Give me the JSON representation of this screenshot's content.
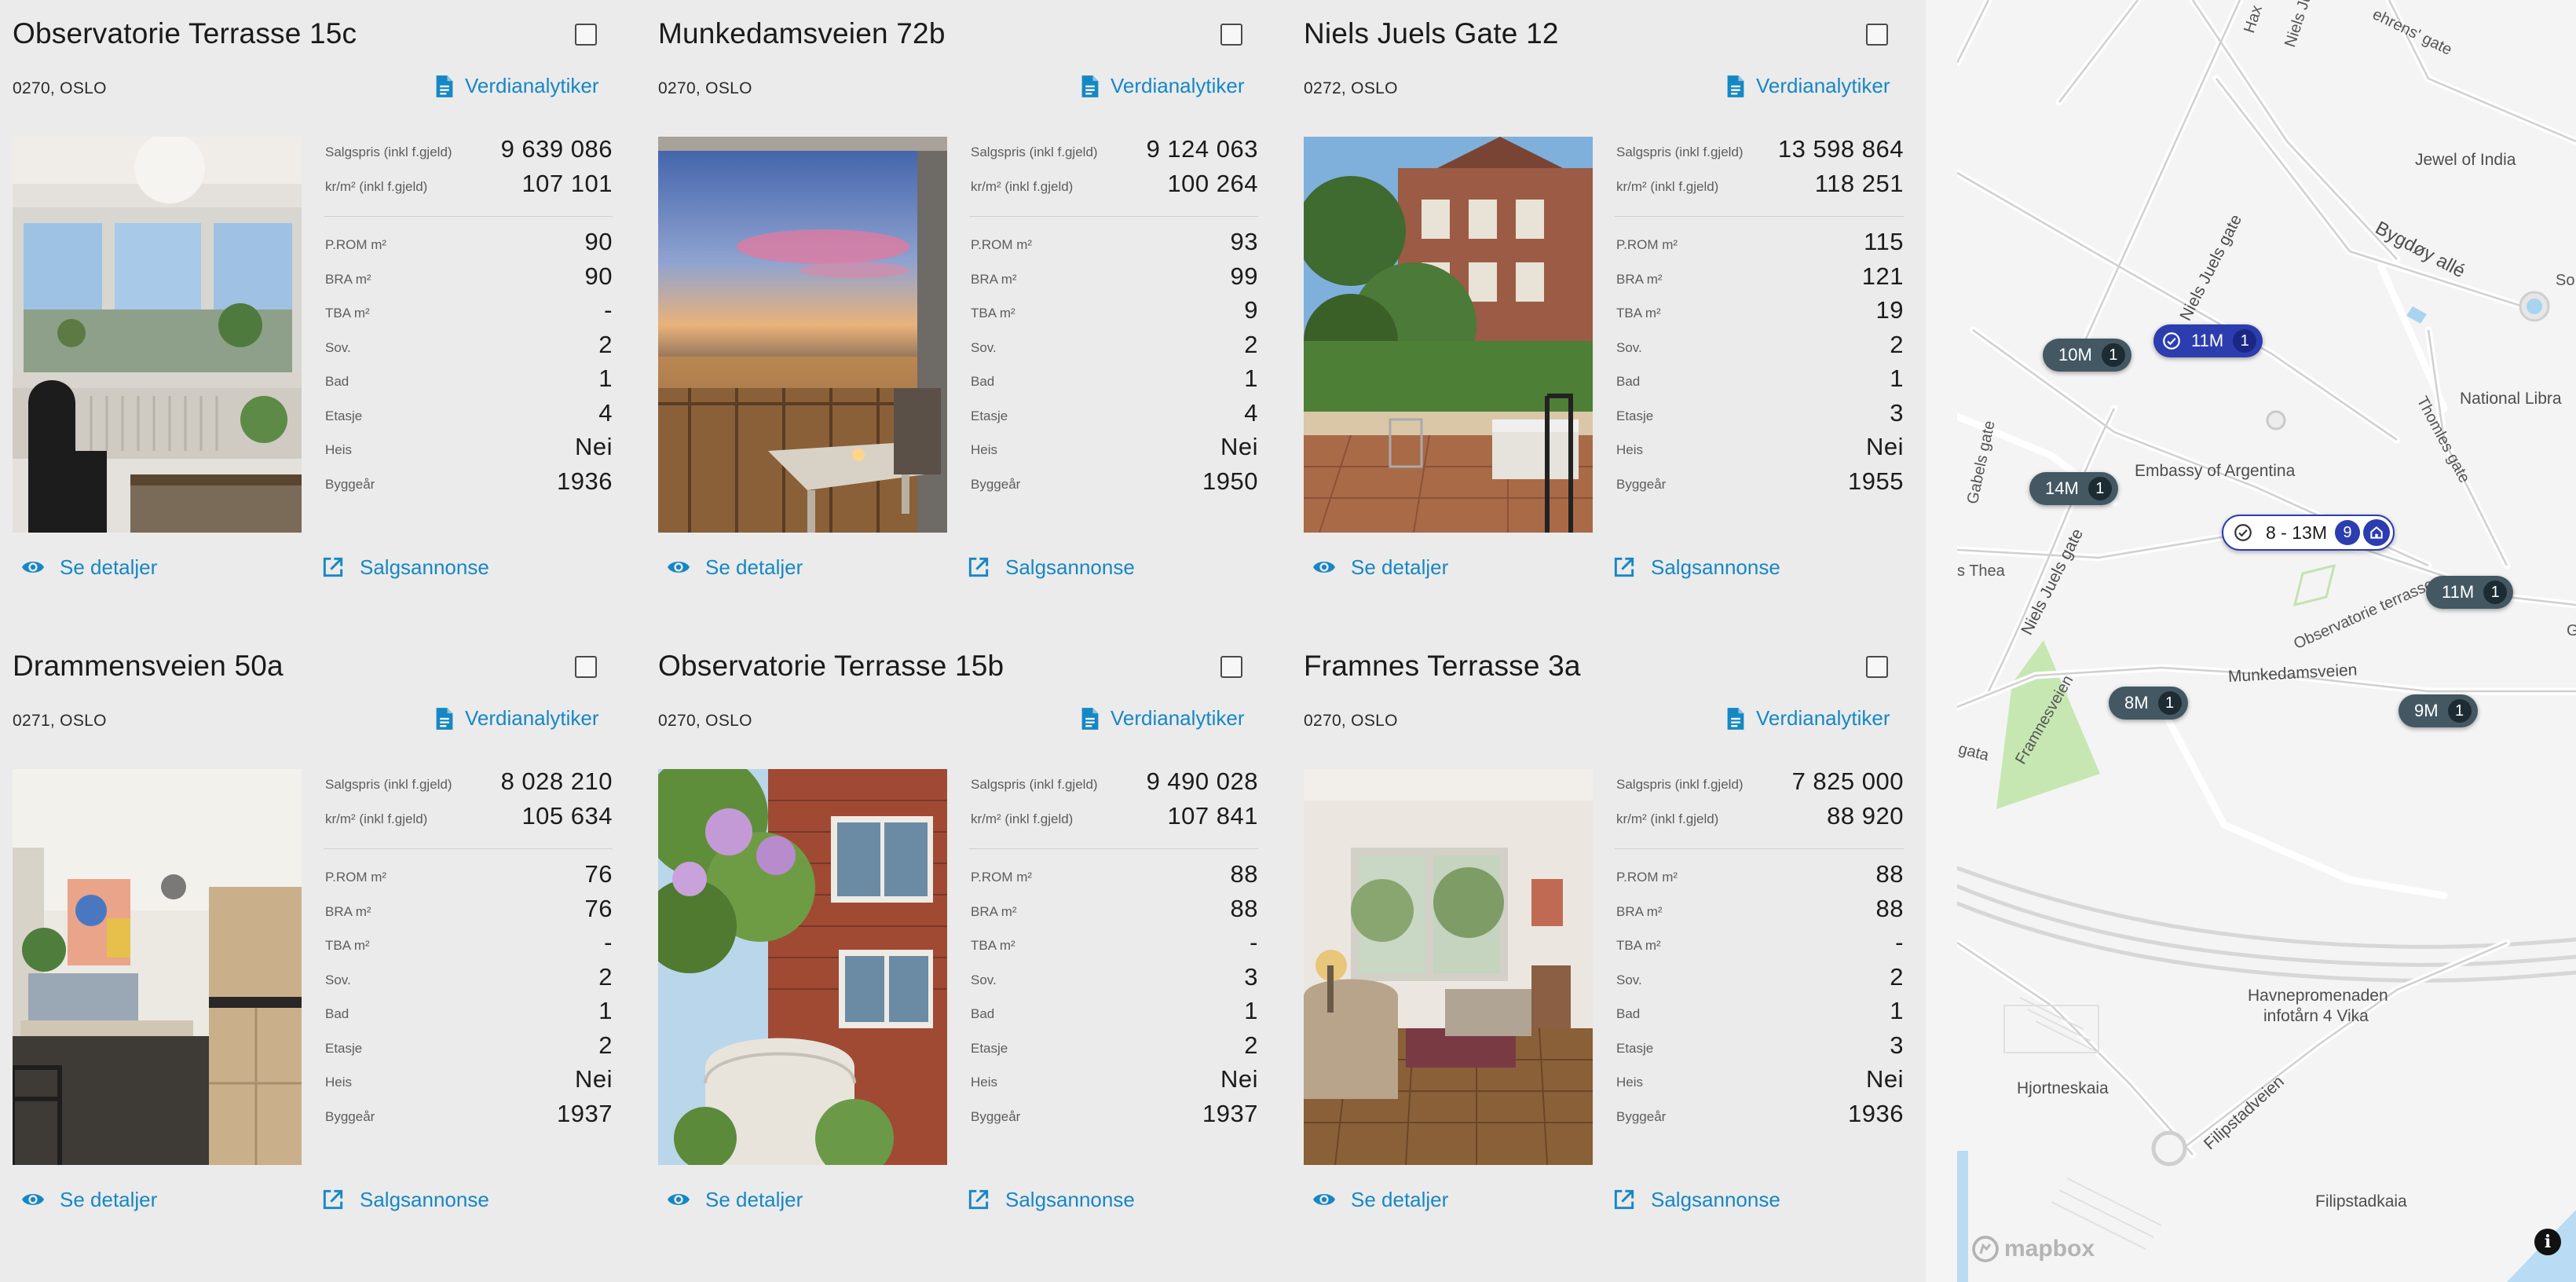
{
  "listings": [
    {
      "title": "Observatorie Terrasse 15c",
      "address": "0270, OSLO",
      "analytics_label": "Verdianalytiker",
      "salgspris_label": "Salgspris (inkl f.gjeld)",
      "salgspris": "9 639 086",
      "krm2_label": "kr/m² (inkl f.gjeld)",
      "krm2": "107 101",
      "prom_label": "P.ROM m²",
      "prom": "90",
      "bra_label": "BRA m²",
      "bra": "90",
      "tba_label": "TBA m²",
      "tba": "-",
      "sov_label": "Sov.",
      "sov": "2",
      "bad_label": "Bad",
      "bad": "1",
      "etasje_label": "Etasje",
      "etasje": "4",
      "heis_label": "Heis",
      "heis": "Nei",
      "bygg_label": "Byggeår",
      "bygg": "1936",
      "details_label": "Se detaljer",
      "ad_label": "Salgsannonse"
    },
    {
      "title": "Munkedamsveien 72b",
      "address": "0270, OSLO",
      "analytics_label": "Verdianalytiker",
      "salgspris_label": "Salgspris (inkl f.gjeld)",
      "salgspris": "9 124 063",
      "krm2_label": "kr/m² (inkl f.gjeld)",
      "krm2": "100 264",
      "prom_label": "P.ROM m²",
      "prom": "93",
      "bra_label": "BRA m²",
      "bra": "99",
      "tba_label": "TBA m²",
      "tba": "9",
      "sov_label": "Sov.",
      "sov": "2",
      "bad_label": "Bad",
      "bad": "1",
      "etasje_label": "Etasje",
      "etasje": "4",
      "heis_label": "Heis",
      "heis": "Nei",
      "bygg_label": "Byggeår",
      "bygg": "1950",
      "details_label": "Se detaljer",
      "ad_label": "Salgsannonse"
    },
    {
      "title": "Niels Juels Gate 12",
      "address": "0272, OSLO",
      "analytics_label": "Verdianalytiker",
      "salgspris_label": "Salgspris (inkl f.gjeld)",
      "salgspris": "13 598 864",
      "krm2_label": "kr/m² (inkl f.gjeld)",
      "krm2": "118 251",
      "prom_label": "P.ROM m²",
      "prom": "115",
      "bra_label": "BRA m²",
      "bra": "121",
      "tba_label": "TBA m²",
      "tba": "19",
      "sov_label": "Sov.",
      "sov": "2",
      "bad_label": "Bad",
      "bad": "1",
      "etasje_label": "Etasje",
      "etasje": "3",
      "heis_label": "Heis",
      "heis": "Nei",
      "bygg_label": "Byggeår",
      "bygg": "1955",
      "details_label": "Se detaljer",
      "ad_label": "Salgsannonse"
    },
    {
      "title": "Drammensveien 50a",
      "address": "0271, OSLO",
      "analytics_label": "Verdianalytiker",
      "salgspris_label": "Salgspris (inkl f.gjeld)",
      "salgspris": "8 028 210",
      "krm2_label": "kr/m² (inkl f.gjeld)",
      "krm2": "105 634",
      "prom_label": "P.ROM m²",
      "prom": "76",
      "bra_label": "BRA m²",
      "bra": "76",
      "tba_label": "TBA m²",
      "tba": "-",
      "sov_label": "Sov.",
      "sov": "2",
      "bad_label": "Bad",
      "bad": "1",
      "etasje_label": "Etasje",
      "etasje": "2",
      "heis_label": "Heis",
      "heis": "Nei",
      "bygg_label": "Byggeår",
      "bygg": "1937",
      "details_label": "Se detaljer",
      "ad_label": "Salgsannonse"
    },
    {
      "title": "Observatorie Terrasse 15b",
      "address": "0270, OSLO",
      "analytics_label": "Verdianalytiker",
      "salgspris_label": "Salgspris (inkl f.gjeld)",
      "salgspris": "9 490 028",
      "krm2_label": "kr/m² (inkl f.gjeld)",
      "krm2": "107 841",
      "prom_label": "P.ROM m²",
      "prom": "88",
      "bra_label": "BRA m²",
      "bra": "88",
      "tba_label": "TBA m²",
      "tba": "-",
      "sov_label": "Sov.",
      "sov": "3",
      "bad_label": "Bad",
      "bad": "1",
      "etasje_label": "Etasje",
      "etasje": "2",
      "heis_label": "Heis",
      "heis": "Nei",
      "bygg_label": "Byggeår",
      "bygg": "1937",
      "details_label": "Se detaljer",
      "ad_label": "Salgsannonse"
    },
    {
      "title": "Framnes Terrasse 3a",
      "address": "0270, OSLO",
      "analytics_label": "Verdianalytiker",
      "salgspris_label": "Salgspris (inkl f.gjeld)",
      "salgspris": "7 825 000",
      "krm2_label": "kr/m² (inkl f.gjeld)",
      "krm2": "88 920",
      "prom_label": "P.ROM m²",
      "prom": "88",
      "bra_label": "BRA m²",
      "bra": "88",
      "tba_label": "TBA m²",
      "tba": "-",
      "sov_label": "Sov.",
      "sov": "2",
      "bad_label": "Bad",
      "bad": "1",
      "etasje_label": "Etasje",
      "etasje": "3",
      "heis_label": "Heis",
      "heis": "Nei",
      "bygg_label": "Byggeår",
      "bygg": "1936",
      "details_label": "Se detaljer",
      "ad_label": "Salgsannonse"
    }
  ],
  "map": {
    "markers": [
      {
        "price": "10M",
        "count": "1"
      },
      {
        "price": "11M",
        "count": "1",
        "selected": true
      },
      {
        "price": "14M",
        "count": "1"
      },
      {
        "price": "11M",
        "count": "1"
      },
      {
        "price": "8M",
        "count": "1"
      },
      {
        "price": "9M",
        "count": "1"
      }
    ],
    "cluster": {
      "range": "8 - 13M",
      "count": "9"
    },
    "labels": {
      "jewel": "Jewel of India",
      "bygdoy": "Bygdøy allé",
      "national": "National Libra",
      "embassy": "Embassy of Argentina",
      "niels_top": "Niels Juels gate",
      "niels_bottom": "Niels Juels gate",
      "thomles": "Thomles gate",
      "gabels": "Gabels gate",
      "observatorie": "Observatorie terrasse",
      "munkedamsveien": "Munkedamsveien",
      "framnesveien": "Framnesveien",
      "thea": "s Thea",
      "gata": "gata",
      "havne1": "Havnepromenaden",
      "havne2": "infotårn 4 Vika",
      "hjortneskaia": "Hjortneskaia",
      "filipstadveien": "Filipstadveien",
      "filipstadkaia": "Filipstadkaia",
      "niels_topedge": "Niels Ju",
      "fehrens": "ehrens' gate",
      "hax": "Hax",
      "so": "So",
      "g": "G"
    },
    "attribution": "mapbox",
    "info": "i"
  },
  "colors": {
    "accent": "#1787c4",
    "pin_dark": "#435863",
    "pin_blue": "#2c3db0",
    "park": "#c5e8b0"
  }
}
